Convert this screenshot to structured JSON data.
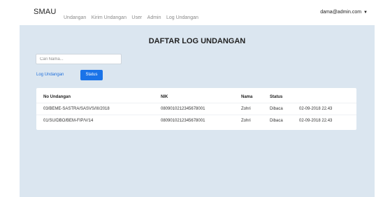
{
  "navbar": {
    "brand": "SMAU",
    "links": [
      "Undangan",
      "Kirim Undangan",
      "User",
      "Admin",
      "Log Undangan"
    ],
    "user": "dama@admin.com"
  },
  "page": {
    "title": "DAFTAR LOG UNDANGAN",
    "search_placeholder": "Cari Nama...",
    "log_button": "Log Undangan",
    "status_button": "Status"
  },
  "table": {
    "headers": [
      "No Undangan",
      "NIK",
      "Nama",
      "Status",
      ""
    ],
    "rows": [
      [
        "03/BEME-SASTRA/SASVS/III/2018",
        "0809010212345678001",
        "Zohri",
        "Dibaca",
        "02-09-2018 22.43"
      ],
      [
        "01/SU/DBO/BEM-FIP/V/14",
        "0809010212345678001",
        "Zohri",
        "Dibaca",
        "02-09-2018 22.43"
      ]
    ]
  }
}
